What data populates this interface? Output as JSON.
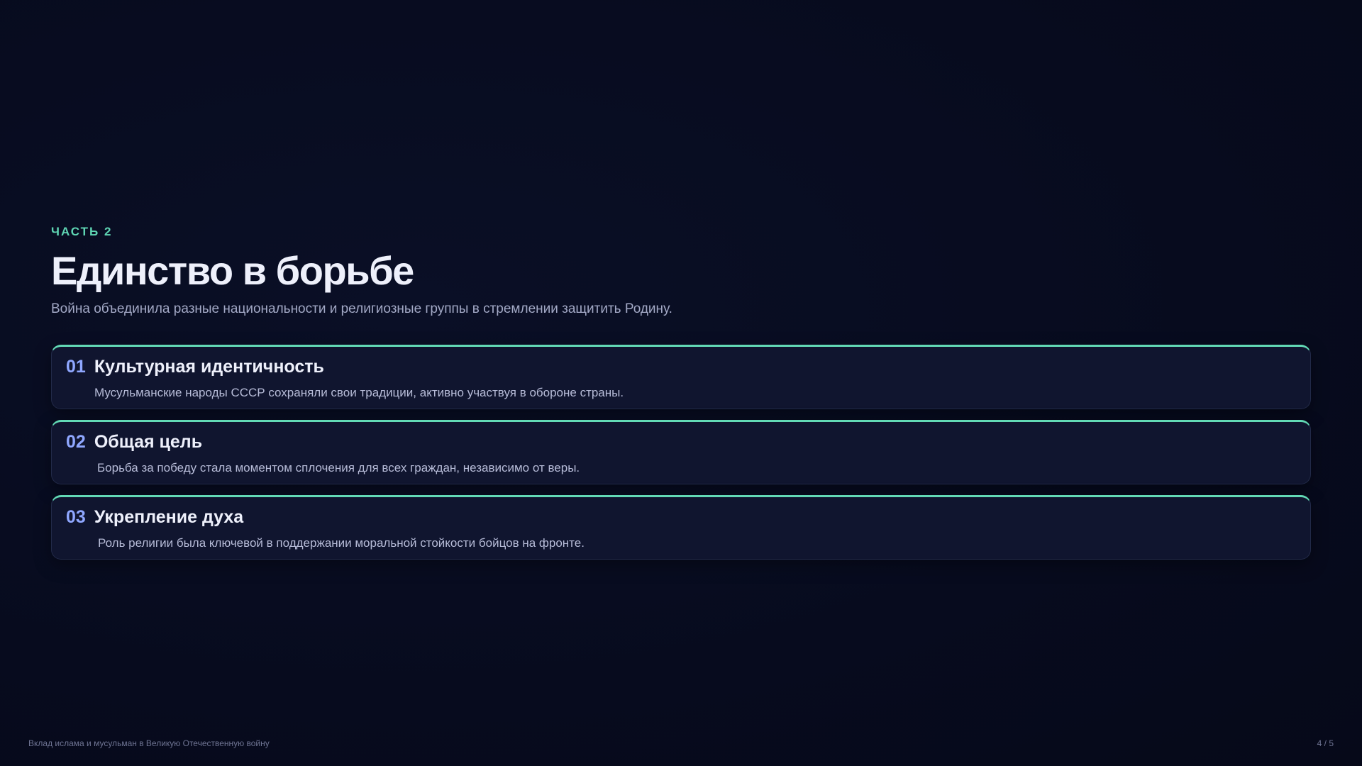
{
  "section": {
    "eyebrow": "ЧАСТЬ 2",
    "title": "Единство в борьбе",
    "subtitle": "Война объединила разные национальности и религиозные группы в стремлении защитить Родину."
  },
  "cards": [
    {
      "number": "01",
      "title": "Культурная идентичность",
      "description": "Мусульманские народы СССР сохраняли свои традиции, активно участвуя в обороне страны."
    },
    {
      "number": "02",
      "title": "Общая цель",
      "description": "Борьба за победу стала моментом сплочения для всех граждан, независимо от веры."
    },
    {
      "number": "03",
      "title": "Укрепление духа",
      "description": "Роль религии была ключевой в поддержании моральной стойкости бойцов на фронте."
    }
  ],
  "footer": {
    "presentation_title": "Вклад ислама и мусульман в Великую Отечественную войну",
    "page_indicator": "4 / 5"
  },
  "colors": {
    "background": "#070b1e",
    "accent": "#62d9b5",
    "number": "#8fa7ff",
    "card_bg": "#10152f"
  }
}
